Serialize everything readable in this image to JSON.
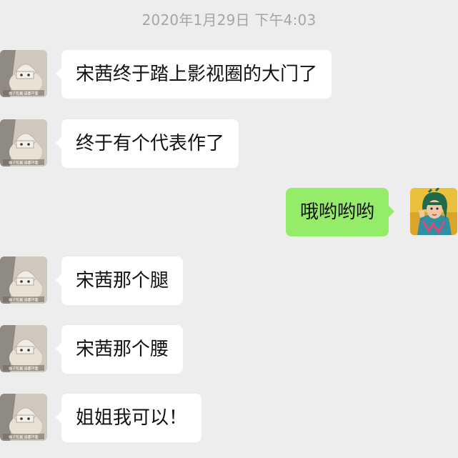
{
  "chat": {
    "timestamp": "2020年1月29日 下午4:03",
    "messages": [
      {
        "sender": "friend",
        "text": "宋茜终于踏上影视圈的大门了"
      },
      {
        "sender": "friend",
        "text": "终于有个代表作了"
      },
      {
        "sender": "me",
        "text": "哦哟哟哟"
      },
      {
        "sender": "friend",
        "text": "宋茜那个腿"
      },
      {
        "sender": "friend",
        "text": "宋茜那个腰"
      },
      {
        "sender": "friend",
        "text": "姐姐我可以！"
      }
    ]
  },
  "avatars": {
    "friend": {
      "icon": "cat-in-hat-avatar",
      "caption": "帽子乱戴 道都不要"
    },
    "me": {
      "icon": "cartoon-girl-avatar"
    }
  },
  "colors": {
    "background": "#ededed",
    "incoming_bubble": "#ffffff",
    "outgoing_bubble": "#95ec69",
    "timestamp": "#a6a6a6"
  }
}
